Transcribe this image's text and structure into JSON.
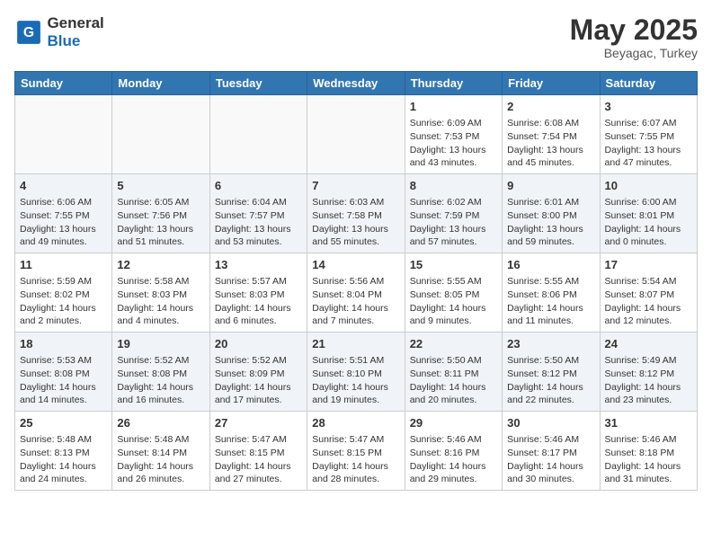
{
  "header": {
    "logo_line1": "General",
    "logo_line2": "Blue",
    "month": "May 2025",
    "location": "Beyagac, Turkey"
  },
  "weekdays": [
    "Sunday",
    "Monday",
    "Tuesday",
    "Wednesday",
    "Thursday",
    "Friday",
    "Saturday"
  ],
  "weeks": [
    [
      {
        "day": "",
        "info": ""
      },
      {
        "day": "",
        "info": ""
      },
      {
        "day": "",
        "info": ""
      },
      {
        "day": "",
        "info": ""
      },
      {
        "day": "1",
        "info": "Sunrise: 6:09 AM\nSunset: 7:53 PM\nDaylight: 13 hours\nand 43 minutes."
      },
      {
        "day": "2",
        "info": "Sunrise: 6:08 AM\nSunset: 7:54 PM\nDaylight: 13 hours\nand 45 minutes."
      },
      {
        "day": "3",
        "info": "Sunrise: 6:07 AM\nSunset: 7:55 PM\nDaylight: 13 hours\nand 47 minutes."
      }
    ],
    [
      {
        "day": "4",
        "info": "Sunrise: 6:06 AM\nSunset: 7:55 PM\nDaylight: 13 hours\nand 49 minutes."
      },
      {
        "day": "5",
        "info": "Sunrise: 6:05 AM\nSunset: 7:56 PM\nDaylight: 13 hours\nand 51 minutes."
      },
      {
        "day": "6",
        "info": "Sunrise: 6:04 AM\nSunset: 7:57 PM\nDaylight: 13 hours\nand 53 minutes."
      },
      {
        "day": "7",
        "info": "Sunrise: 6:03 AM\nSunset: 7:58 PM\nDaylight: 13 hours\nand 55 minutes."
      },
      {
        "day": "8",
        "info": "Sunrise: 6:02 AM\nSunset: 7:59 PM\nDaylight: 13 hours\nand 57 minutes."
      },
      {
        "day": "9",
        "info": "Sunrise: 6:01 AM\nSunset: 8:00 PM\nDaylight: 13 hours\nand 59 minutes."
      },
      {
        "day": "10",
        "info": "Sunrise: 6:00 AM\nSunset: 8:01 PM\nDaylight: 14 hours\nand 0 minutes."
      }
    ],
    [
      {
        "day": "11",
        "info": "Sunrise: 5:59 AM\nSunset: 8:02 PM\nDaylight: 14 hours\nand 2 minutes."
      },
      {
        "day": "12",
        "info": "Sunrise: 5:58 AM\nSunset: 8:03 PM\nDaylight: 14 hours\nand 4 minutes."
      },
      {
        "day": "13",
        "info": "Sunrise: 5:57 AM\nSunset: 8:03 PM\nDaylight: 14 hours\nand 6 minutes."
      },
      {
        "day": "14",
        "info": "Sunrise: 5:56 AM\nSunset: 8:04 PM\nDaylight: 14 hours\nand 7 minutes."
      },
      {
        "day": "15",
        "info": "Sunrise: 5:55 AM\nSunset: 8:05 PM\nDaylight: 14 hours\nand 9 minutes."
      },
      {
        "day": "16",
        "info": "Sunrise: 5:55 AM\nSunset: 8:06 PM\nDaylight: 14 hours\nand 11 minutes."
      },
      {
        "day": "17",
        "info": "Sunrise: 5:54 AM\nSunset: 8:07 PM\nDaylight: 14 hours\nand 12 minutes."
      }
    ],
    [
      {
        "day": "18",
        "info": "Sunrise: 5:53 AM\nSunset: 8:08 PM\nDaylight: 14 hours\nand 14 minutes."
      },
      {
        "day": "19",
        "info": "Sunrise: 5:52 AM\nSunset: 8:08 PM\nDaylight: 14 hours\nand 16 minutes."
      },
      {
        "day": "20",
        "info": "Sunrise: 5:52 AM\nSunset: 8:09 PM\nDaylight: 14 hours\nand 17 minutes."
      },
      {
        "day": "21",
        "info": "Sunrise: 5:51 AM\nSunset: 8:10 PM\nDaylight: 14 hours\nand 19 minutes."
      },
      {
        "day": "22",
        "info": "Sunrise: 5:50 AM\nSunset: 8:11 PM\nDaylight: 14 hours\nand 20 minutes."
      },
      {
        "day": "23",
        "info": "Sunrise: 5:50 AM\nSunset: 8:12 PM\nDaylight: 14 hours\nand 22 minutes."
      },
      {
        "day": "24",
        "info": "Sunrise: 5:49 AM\nSunset: 8:12 PM\nDaylight: 14 hours\nand 23 minutes."
      }
    ],
    [
      {
        "day": "25",
        "info": "Sunrise: 5:48 AM\nSunset: 8:13 PM\nDaylight: 14 hours\nand 24 minutes."
      },
      {
        "day": "26",
        "info": "Sunrise: 5:48 AM\nSunset: 8:14 PM\nDaylight: 14 hours\nand 26 minutes."
      },
      {
        "day": "27",
        "info": "Sunrise: 5:47 AM\nSunset: 8:15 PM\nDaylight: 14 hours\nand 27 minutes."
      },
      {
        "day": "28",
        "info": "Sunrise: 5:47 AM\nSunset: 8:15 PM\nDaylight: 14 hours\nand 28 minutes."
      },
      {
        "day": "29",
        "info": "Sunrise: 5:46 AM\nSunset: 8:16 PM\nDaylight: 14 hours\nand 29 minutes."
      },
      {
        "day": "30",
        "info": "Sunrise: 5:46 AM\nSunset: 8:17 PM\nDaylight: 14 hours\nand 30 minutes."
      },
      {
        "day": "31",
        "info": "Sunrise: 5:46 AM\nSunset: 8:18 PM\nDaylight: 14 hours\nand 31 minutes."
      }
    ]
  ]
}
